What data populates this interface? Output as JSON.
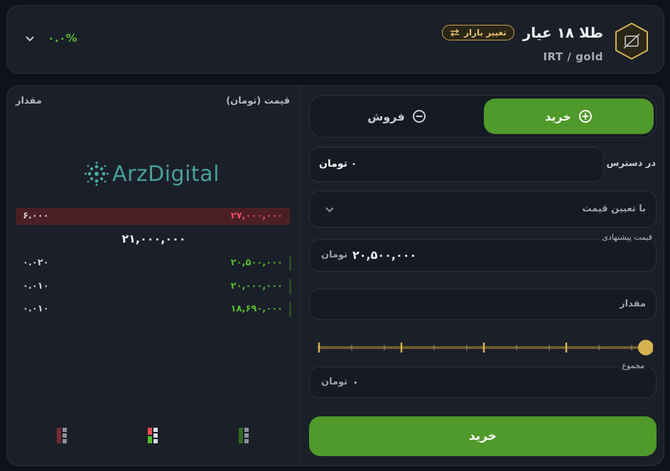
{
  "header": {
    "asset_name": "طلا ۱۸ عیار",
    "market_change_label": "تغییر بازار",
    "pair": "IRT / gold",
    "change_percent": "۰.۰%"
  },
  "order_book": {
    "price_header": "قیمت (تومان)",
    "amount_header": "مقدار",
    "logo_text": "ArzDigital",
    "asks": [
      {
        "price": "۲۷,۰۰۰,۰۰۰",
        "amount": "۶.۰۰۰"
      }
    ],
    "last_price": "۲۱,۰۰۰,۰۰۰",
    "bids": [
      {
        "price": "۲۰,۵۰۰,۰۰۰",
        "amount": "۰.۰۲۰"
      },
      {
        "price": "۲۰,۰۰۰,۰۰۰",
        "amount": "۰.۰۱۰"
      },
      {
        "price": "۱۸,۶۹۰,۰۰۰",
        "amount": "۰.۰۱۰"
      }
    ]
  },
  "form": {
    "buy_tab": "خرید",
    "sell_tab": "فروش",
    "available_label": "در دسترس",
    "available_value": "۰ تومان",
    "order_type": "با تعیین قیمت",
    "offer_price_label": "قیمت پیشنهادی",
    "offer_price_value": "۲۰,۵۰۰,۰۰۰",
    "offer_price_unit": "تومان",
    "amount_placeholder": "مقدار",
    "slider_level": 1.0,
    "total_label": "مجموع",
    "total_value": "۰",
    "total_unit": "تومان",
    "submit_label": "خرید"
  },
  "colors": {
    "buy_green": "#4f9a2a",
    "bid_text": "#54bd2b",
    "ask_text": "#ee4b56",
    "gold": "#d6b24f"
  }
}
